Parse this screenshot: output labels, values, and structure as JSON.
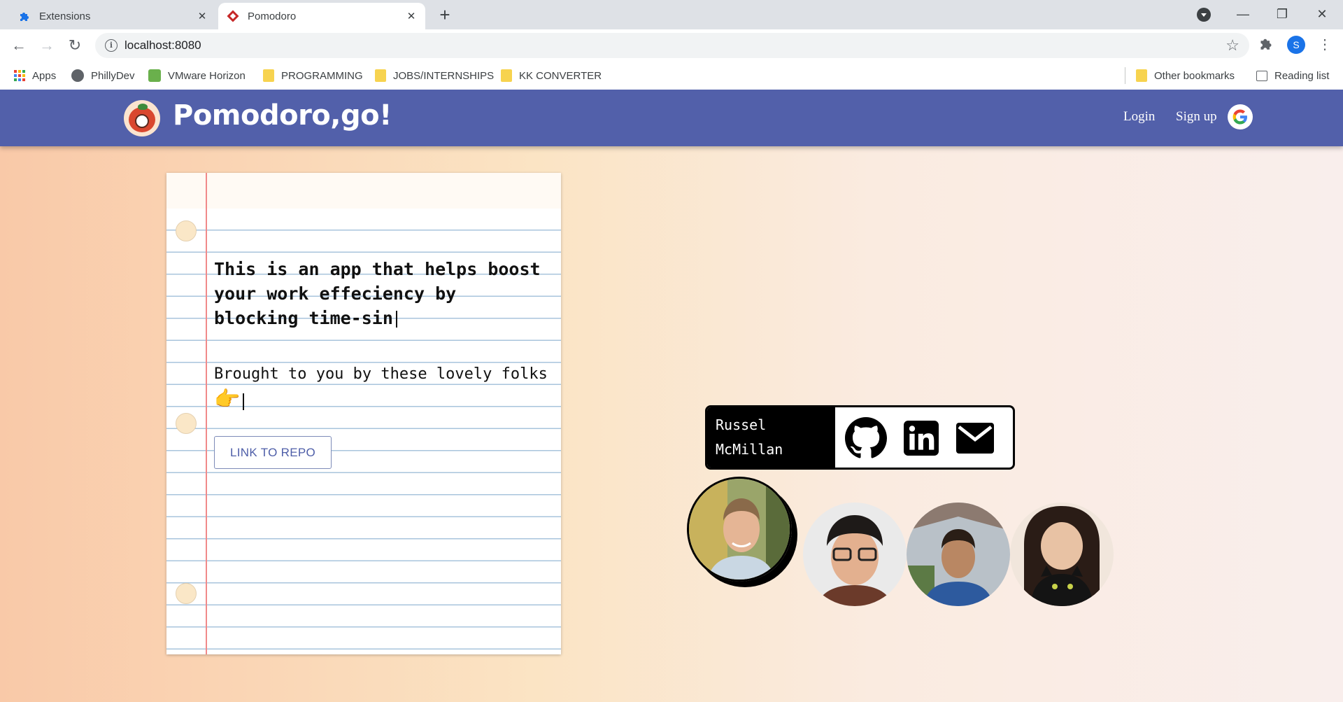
{
  "browser": {
    "tabs": [
      {
        "title": "Extensions",
        "active": false
      },
      {
        "title": "Pomodoro",
        "active": true
      }
    ],
    "url": "localhost:8080",
    "profile_initial": "S",
    "bookmarks": [
      "Apps",
      "PhillyDev",
      "VMware Horizon",
      "PROGRAMMING",
      "JOBS/INTERNSHIPS",
      "KK CONVERTER"
    ],
    "other_bookmarks": "Other bookmarks",
    "reading_list": "Reading list"
  },
  "app": {
    "brand": "Pomodoro,go!",
    "nav": {
      "login": "Login",
      "signup": "Sign up"
    },
    "brand_color": "#5260aa"
  },
  "notebook": {
    "text1": "This is an app that helps boost your work effeciency by blocking time-sin",
    "text2": "Brought to you by these lovely folks",
    "repo_button": "LINK TO REPO"
  },
  "team": {
    "selected_name": "Russel McMillan",
    "members_count": 4
  }
}
